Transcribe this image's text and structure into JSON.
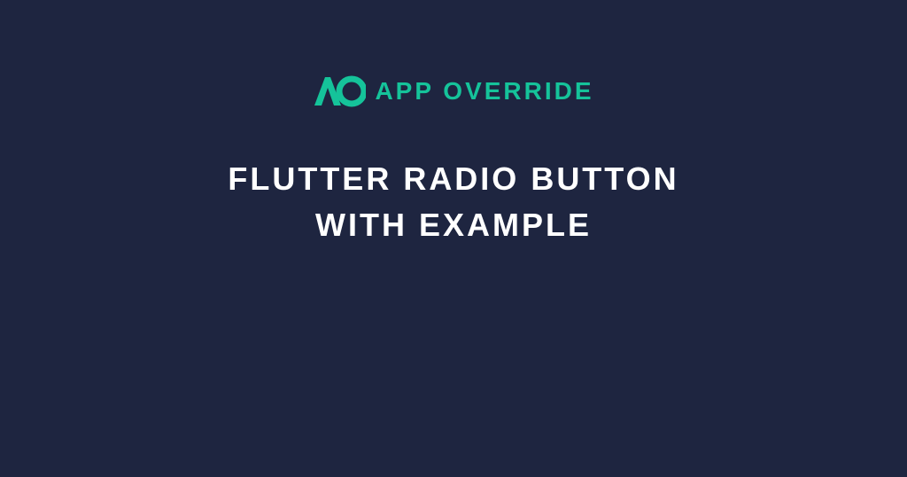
{
  "logo": {
    "text": "APP OVERRIDE",
    "icon_name": "ao-logo-icon"
  },
  "title": {
    "line1": "FLUTTER RADIO BUTTON",
    "line2": "WITH EXAMPLE"
  },
  "colors": {
    "background": "#1e2540",
    "accent": "#15c39a",
    "text": "#ffffff"
  }
}
